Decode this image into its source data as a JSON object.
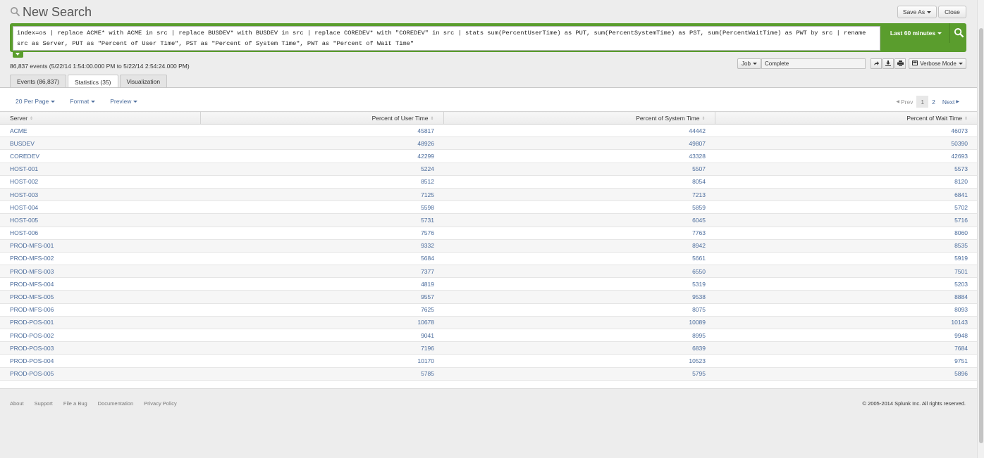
{
  "header": {
    "title": "New Search",
    "save_as_label": "Save As",
    "close_label": "Close"
  },
  "search": {
    "query": "index=os | replace ACME* with ACME in src | replace BUSDEV* with BUSDEV in src | replace COREDEV* with \"COREDEV\" in src | stats sum(PercentUserTime) as PUT, sum(PercentSystemTime) as PST, sum(PercentWaitTime) as PWT by src | rename src as Server, PUT as \"Percent of User Time\", PST as \"Percent of System Time\", PWT as \"Percent of Wait Time\"",
    "time_range": "Last 60 minutes"
  },
  "meta": {
    "events_summary": "86,837 events (5/22/14 1:54:00.000 PM to 5/22/14 2:54:24.000 PM)"
  },
  "job": {
    "label": "Job",
    "status": "Complete",
    "mode_label": "Verbose Mode"
  },
  "tabs": [
    {
      "label": "Events (86,837)",
      "active": false
    },
    {
      "label": "Statistics (35)",
      "active": true
    },
    {
      "label": "Visualization",
      "active": false
    }
  ],
  "controls": {
    "per_page": "20 Per Page",
    "format": "Format",
    "preview": "Preview"
  },
  "pager": {
    "prev": "Prev",
    "pages": [
      "1",
      "2"
    ],
    "current": "1",
    "next": "Next"
  },
  "table": {
    "columns": [
      "Server",
      "Percent of User Time",
      "Percent of System Time",
      "Percent of Wait Time"
    ],
    "rows": [
      [
        "ACME",
        "45817",
        "44442",
        "46073"
      ],
      [
        "BUSDEV",
        "48926",
        "49807",
        "50390"
      ],
      [
        "COREDEV",
        "42299",
        "43328",
        "42693"
      ],
      [
        "HOST-001",
        "5224",
        "5507",
        "5573"
      ],
      [
        "HOST-002",
        "8512",
        "8054",
        "8120"
      ],
      [
        "HOST-003",
        "7125",
        "7213",
        "6841"
      ],
      [
        "HOST-004",
        "5598",
        "5859",
        "5702"
      ],
      [
        "HOST-005",
        "5731",
        "6045",
        "5716"
      ],
      [
        "HOST-006",
        "7576",
        "7763",
        "8060"
      ],
      [
        "PROD-MFS-001",
        "9332",
        "8942",
        "8535"
      ],
      [
        "PROD-MFS-002",
        "5684",
        "5661",
        "5919"
      ],
      [
        "PROD-MFS-003",
        "7377",
        "6550",
        "7501"
      ],
      [
        "PROD-MFS-004",
        "4819",
        "5319",
        "5203"
      ],
      [
        "PROD-MFS-005",
        "9557",
        "9538",
        "8884"
      ],
      [
        "PROD-MFS-006",
        "7625",
        "8075",
        "8093"
      ],
      [
        "PROD-POS-001",
        "10678",
        "10089",
        "10143"
      ],
      [
        "PROD-POS-002",
        "9041",
        "8995",
        "9948"
      ],
      [
        "PROD-POS-003",
        "7196",
        "6839",
        "7684"
      ],
      [
        "PROD-POS-004",
        "10170",
        "10523",
        "9751"
      ],
      [
        "PROD-POS-005",
        "5785",
        "5795",
        "5896"
      ]
    ]
  },
  "footer": {
    "links": [
      "About",
      "Support",
      "File a Bug",
      "Documentation",
      "Privacy Policy"
    ],
    "copyright": "© 2005-2014 Splunk Inc. All rights reserved."
  },
  "colors": {
    "search_green": "#5a9d2d",
    "link_blue": "#4b6c9c"
  },
  "icons": [
    "search-icon",
    "share-icon",
    "export-icon",
    "print-icon",
    "verbose-mode-icon"
  ]
}
